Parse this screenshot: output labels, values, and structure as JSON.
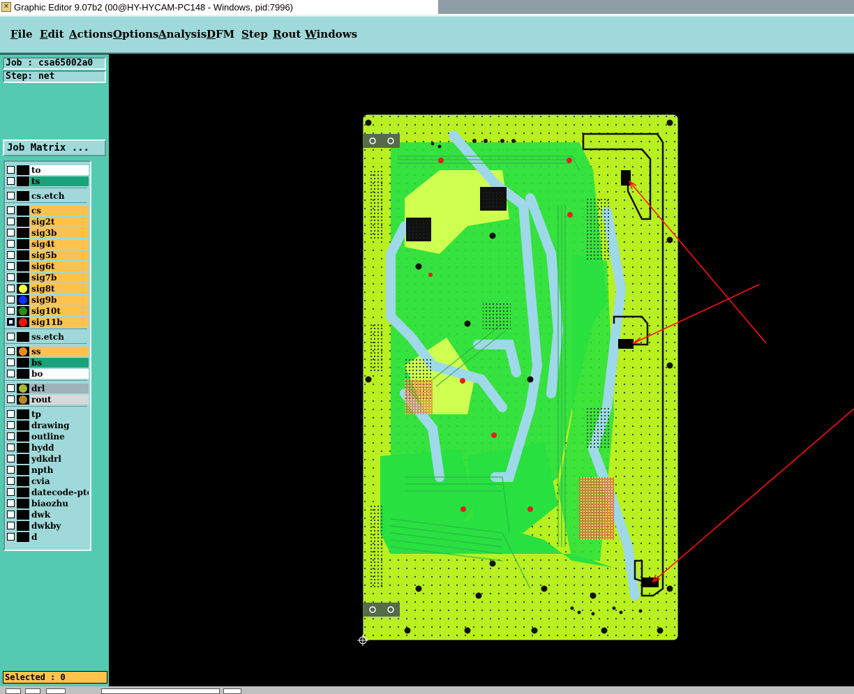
{
  "window": {
    "title": "Graphic Editor 9.07b2 (00@HY-HYCAM-PC148 - Windows, pid:7996)"
  },
  "menu": [
    "File",
    "Edit",
    "Actions",
    "Options",
    "Analysis",
    "DFM",
    "Step",
    "Rout",
    "Windows"
  ],
  "job": {
    "job_label": "Job : csa65002a0",
    "step_label": "Step: net",
    "matrix_button": "Job Matrix ..."
  },
  "layers": [
    {
      "name": "to",
      "bg": "#ffffff",
      "dot": ""
    },
    {
      "name": "ts",
      "bg": "#1aa37a",
      "dot": ""
    },
    {
      "name": "cs.etch",
      "bg": "#a0d9d9",
      "dot": ""
    },
    {
      "name": "cs",
      "bg": "#ffc34d",
      "dot": ""
    },
    {
      "name": "sig2t",
      "bg": "#ffc34d",
      "dot": ""
    },
    {
      "name": "sig3b",
      "bg": "#ffc34d",
      "dot": ""
    },
    {
      "name": "sig4t",
      "bg": "#ffc34d",
      "dot": ""
    },
    {
      "name": "sig5b",
      "bg": "#ffc34d",
      "dot": ""
    },
    {
      "name": "sig6t",
      "bg": "#ffc34d",
      "dot": ""
    },
    {
      "name": "sig7b",
      "bg": "#ffc34d",
      "dot": ""
    },
    {
      "name": "sig8t",
      "bg": "#ffc34d",
      "dot": "#ffff40"
    },
    {
      "name": "sig9b",
      "bg": "#ffc34d",
      "dot": "#1030ff"
    },
    {
      "name": "sig10t",
      "bg": "#ffc34d",
      "dot": "#2a8a1a"
    },
    {
      "name": "sig11b",
      "bg": "#ffc34d",
      "dot": "#ff1010",
      "checked": true
    },
    {
      "name": "ss.etch",
      "bg": "#a0d9d9",
      "dot": ""
    },
    {
      "name": "ss",
      "bg": "#ffc34d",
      "dot": "#f08a20"
    },
    {
      "name": "bs",
      "bg": "#1aa37a",
      "dot": ""
    },
    {
      "name": "bo",
      "bg": "#ffffff",
      "dot": ""
    },
    {
      "name": "drl",
      "bg": "#9fb3b8",
      "dot": "#a8b830"
    },
    {
      "name": "rout",
      "bg": "#d8d8d8",
      "dot": "#b8862a"
    },
    {
      "name": "tp",
      "bg": "#a0d9d9",
      "dot": ""
    },
    {
      "name": "drawing",
      "bg": "#a0d9d9",
      "dot": ""
    },
    {
      "name": "outline",
      "bg": "#a0d9d9",
      "dot": ""
    },
    {
      "name": "hydd",
      "bg": "#a0d9d9",
      "dot": ""
    },
    {
      "name": "ydkdrl",
      "bg": "#a0d9d9",
      "dot": ""
    },
    {
      "name": "npth",
      "bg": "#a0d9d9",
      "dot": ""
    },
    {
      "name": "cvia",
      "bg": "#a0d9d9",
      "dot": ""
    },
    {
      "name": "datecode-ptc",
      "bg": "#a0d9d9",
      "dot": ""
    },
    {
      "name": "biaozhu",
      "bg": "#a0d9d9",
      "dot": ""
    },
    {
      "name": "dwk",
      "bg": "#a0d9d9",
      "dot": ""
    },
    {
      "name": "dwkby",
      "bg": "#a0d9d9",
      "dot": ""
    },
    {
      "name": "d",
      "bg": "#a0d9d9",
      "dot": ""
    }
  ],
  "status": {
    "selected": "Selected : 0"
  },
  "colors": {
    "board": "#b8f020",
    "copper": "#28e040",
    "trace_blue": "#9fd8e8",
    "arrow": "#ff1010"
  }
}
